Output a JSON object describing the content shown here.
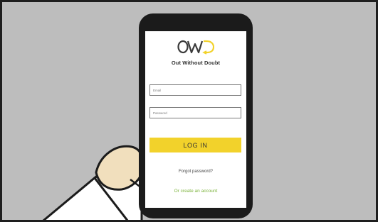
{
  "app": {
    "logo_text": "OWD",
    "brand_name": "Out Without Doubt"
  },
  "login_form": {
    "email_placeholder": "Email",
    "email_value": "",
    "password_placeholder": "Password",
    "password_value": "",
    "login_label": "LOG IN",
    "forgot_label": "Forgot password?",
    "create_label": "Or create an account"
  },
  "colors": {
    "accent_yellow": "#f2d22b",
    "link_green": "#7bb23a",
    "background_gray": "#bdbdbd",
    "phone_body": "#1b1b1b"
  }
}
